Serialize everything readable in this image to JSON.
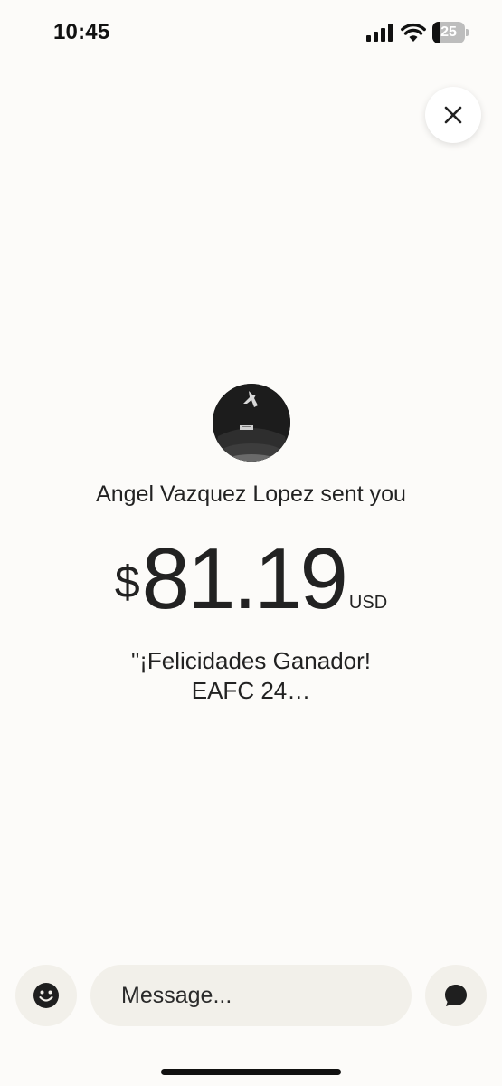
{
  "status_bar": {
    "time": "10:45",
    "battery_level": "25",
    "battery_fraction": 0.25,
    "icons": [
      "signal-icon",
      "wifi-icon",
      "battery-icon"
    ]
  },
  "header": {
    "close_icon": "close-icon"
  },
  "payment": {
    "sender_text": "Angel Vazquez Lopez sent you",
    "currency_symbol": "$",
    "amount": "81.19",
    "currency_code": "USD",
    "note_line1": "\"¡Felicidades Ganador!",
    "note_line2": "EAFC 24…"
  },
  "composer": {
    "emoji_icon": "emoji-icon",
    "message_placeholder": "Message...",
    "message_value": "",
    "send_icon": "chat-bubble-icon"
  },
  "colors": {
    "background": "#fcfbf9",
    "button_background": "#f2f0ea",
    "text": "#222222"
  }
}
